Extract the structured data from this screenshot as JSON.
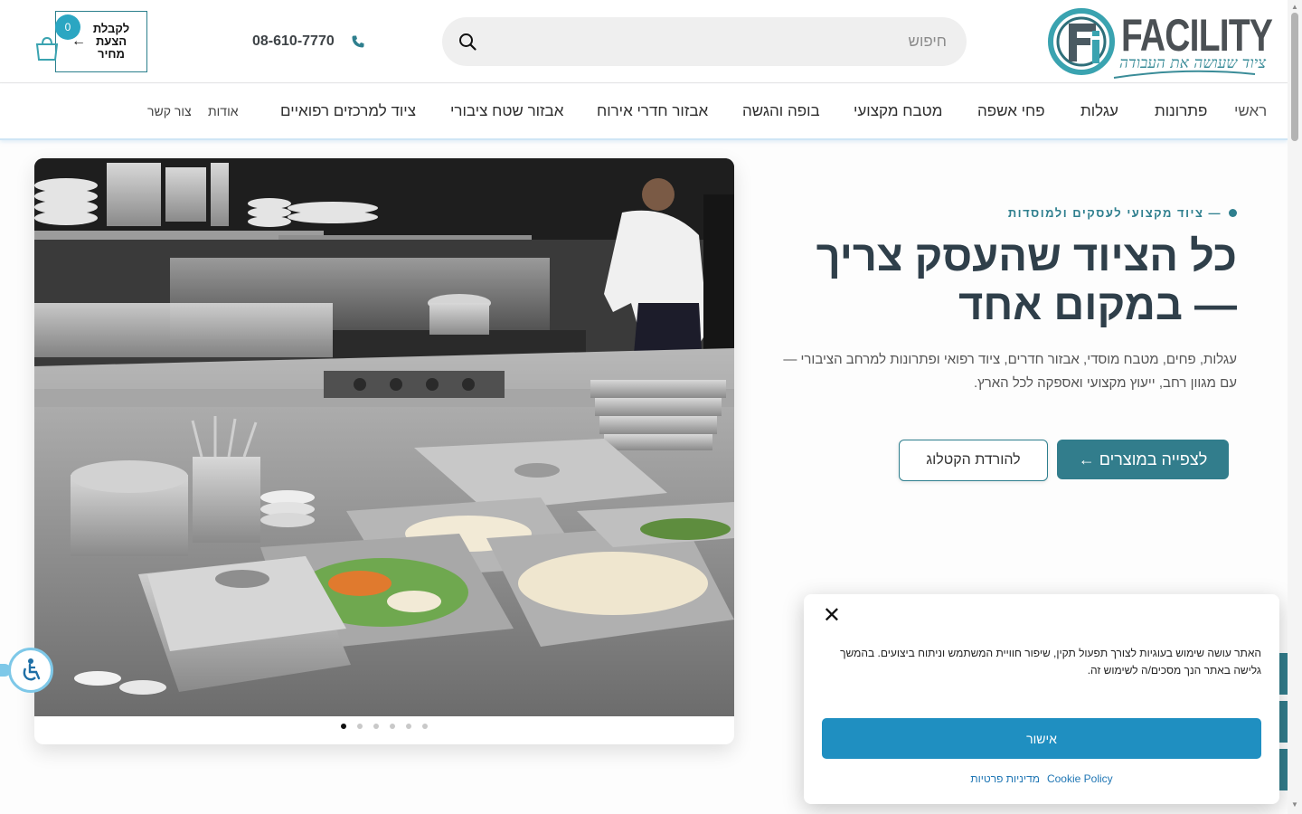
{
  "header": {
    "logo_word": "FACILITY",
    "logo_tagline": "ציוד שעושה את העבודה",
    "search_placeholder": "חיפוש",
    "phone": "08-610-7770",
    "quote_label": "לקבלת הצעת מחיר",
    "quote_arrow": "←",
    "cart_count": "0"
  },
  "nav": {
    "items": [
      "ראשי",
      "פתרונות",
      "עגלות",
      "פחי אשפה",
      "מטבח מקצועי",
      "בופה והגשה",
      "אבזור חדרי אירוח",
      "אבזור שטח ציבורי",
      "ציוד למרכזים רפואיים",
      "אודות",
      "צור קשר"
    ]
  },
  "hero": {
    "eyebrow": "— ציוד מקצועי לעסקים ולמוסדות",
    "title": "כל הציוד שהעסק צריך — במקום אחד",
    "subtitle": "עגלות, פחים, מטבח מוסדי, אבזור חדרים, ציוד רפואי ופתרונות למרחב הציבורי — עם מגוון רחב, ייעוץ מקצועי ואספקה לכל הארץ.",
    "primary_cta": "לצפייה במוצרים ←",
    "secondary_cta": "להורדת הקטלוג"
  },
  "slider": {
    "slide_count": 6,
    "active_index": 0
  },
  "cookie": {
    "text": "האתר עושה שימוש בעוגיות לצורך תפעול תקין, שיפור חוויית המשתמש וניתוח ביצועים. בהמשך גלישה באתר הנך מסכים/ה לשימוש זה.",
    "accept": "אישור",
    "policy_link": "Cookie Policy",
    "privacy_link": "מדיניות פרטיות"
  },
  "colors": {
    "brand_teal": "#327d8c",
    "accept_blue": "#1f8fc1",
    "badge": "#2ba6c2",
    "heading": "#2f3f4a"
  }
}
